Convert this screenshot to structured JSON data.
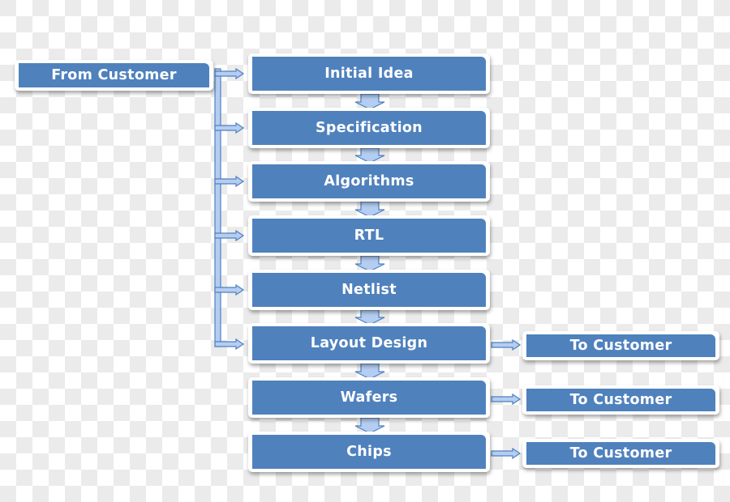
{
  "diagram": {
    "type": "flowchart",
    "source": {
      "label": "From Customer"
    },
    "steps": [
      {
        "label": "Initial Idea"
      },
      {
        "label": "Specification"
      },
      {
        "label": "Algorithms"
      },
      {
        "label": "RTL"
      },
      {
        "label": "Netlist"
      },
      {
        "label": "Layout Design"
      },
      {
        "label": "Wafers"
      },
      {
        "label": "Chips"
      }
    ],
    "outputs": [
      {
        "from_step": "Layout Design",
        "label": "To Customer"
      },
      {
        "from_step": "Wafers",
        "label": "To Customer"
      },
      {
        "from_step": "Chips",
        "label": "To Customer"
      }
    ],
    "source_feeds_steps": [
      "Initial Idea",
      "Specification",
      "Algorithms",
      "RTL",
      "Netlist",
      "Layout Design"
    ],
    "colors": {
      "box_fill": "#4f81bd",
      "box_text": "#ffffff",
      "box_frame": "#ffffff",
      "arrow_fill": "#b4cdf2",
      "arrow_stroke": "#4f81bd"
    }
  }
}
